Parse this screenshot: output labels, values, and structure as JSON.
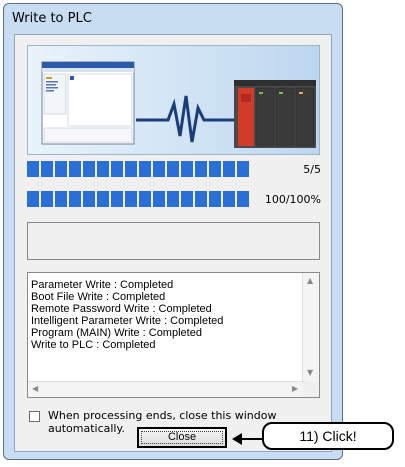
{
  "dialog": {
    "title": "Write to PLC"
  },
  "progress": {
    "overall": {
      "label": "5/5",
      "fraction": 1.0
    },
    "step": {
      "label": "100/100%",
      "fraction": 1.0
    }
  },
  "log": {
    "lines": [
      "Parameter Write : Completed",
      "Boot File Write : Completed",
      "Remote Password Write : Completed",
      "Intelligent Parameter Write : Completed",
      "Program (MAIN) Write : Completed",
      "Write to PLC : Completed"
    ]
  },
  "auto_close": {
    "label": "When processing ends, close this window automatically.",
    "checked": false
  },
  "buttons": {
    "close_label": "Close"
  },
  "annotation": {
    "text": "11) Click!"
  },
  "colors": {
    "progress_fill": "#2a6fd6",
    "plc_red": "#d23a2a",
    "signal_blue": "#1b3d7a"
  }
}
